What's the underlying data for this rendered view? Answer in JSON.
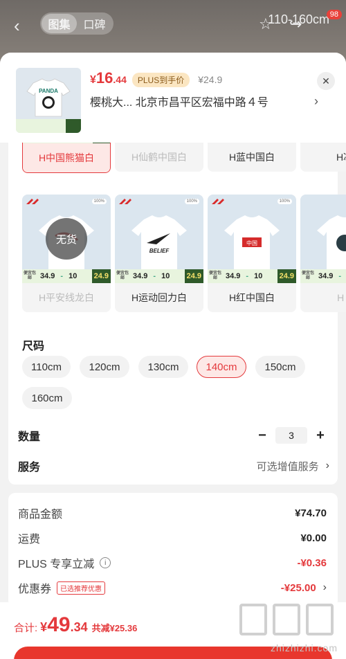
{
  "background": {
    "tabs": [
      {
        "label": "图集",
        "active": true
      },
      {
        "label": "口碑",
        "active": false
      }
    ],
    "size_text": "110-160cm",
    "badge": "98"
  },
  "header": {
    "price_currency": "¥",
    "price_int": "16",
    "price_dec": ".44",
    "plus_tag": "PLUS到手价",
    "original_price": "¥24.9",
    "address": "樱桃大...  北京市昌平区宏福中路４号",
    "close_icon": "close-icon"
  },
  "price_bar": {
    "left": "便宜包邮",
    "price": "34.9",
    "qty": "10",
    "right": "24.9"
  },
  "variants_row1": [
    {
      "label": "H中国熊猫白",
      "selected": true,
      "available": true
    },
    {
      "label": "H仙鹤中国白",
      "selected": false,
      "available": false
    },
    {
      "label": "H蓝中国白",
      "selected": false,
      "available": true
    },
    {
      "label": "H冰",
      "selected": false,
      "available": true
    }
  ],
  "variants_row2": [
    {
      "label": "H平安线龙白",
      "available": false,
      "overlay": "无货",
      "graphic": "dragon"
    },
    {
      "label": "H运动回力白",
      "available": true,
      "graphic": "belief"
    },
    {
      "label": "H红中国白",
      "available": true,
      "graphic": "redbox"
    },
    {
      "label": "H L",
      "available": false,
      "graphic": "partial"
    }
  ],
  "variant_art": {
    "belief_text": "BELIEF",
    "redbox_text": "中国",
    "corner_tag": "100%"
  },
  "size_section": {
    "title": "尺码",
    "options": [
      {
        "label": "110cm",
        "selected": false
      },
      {
        "label": "120cm",
        "selected": false
      },
      {
        "label": "130cm",
        "selected": false
      },
      {
        "label": "140cm",
        "selected": true
      },
      {
        "label": "150cm",
        "selected": false
      },
      {
        "label": "160cm",
        "selected": false
      }
    ]
  },
  "quantity": {
    "label": "数量",
    "minus": "−",
    "value": "3",
    "plus": "+"
  },
  "service": {
    "label": "服务",
    "value": "可选增值服务",
    "chevron": "›"
  },
  "summary": {
    "goods_label": "商品金额",
    "goods_amount": "¥74.70",
    "shipping_label": "运费",
    "shipping_amount": "¥0.00",
    "plus_label": "PLUS 专享立减",
    "plus_info": "i",
    "plus_amount": "-¥0.36",
    "coupon_label": "优惠券",
    "coupon_tag": "已选推荐优惠",
    "coupon_amount": "-¥25.00",
    "coupon_chevron": "›"
  },
  "total": {
    "label": "合计:",
    "currency": "¥",
    "int": "49",
    "dec": ".34",
    "savings": "共减¥25.36"
  },
  "watermark": "zhizhizhi.com",
  "colors": {
    "accent": "#e4393c",
    "plus_bg": "#fbe6c2",
    "price_bar_bg": "#e8f4de"
  }
}
